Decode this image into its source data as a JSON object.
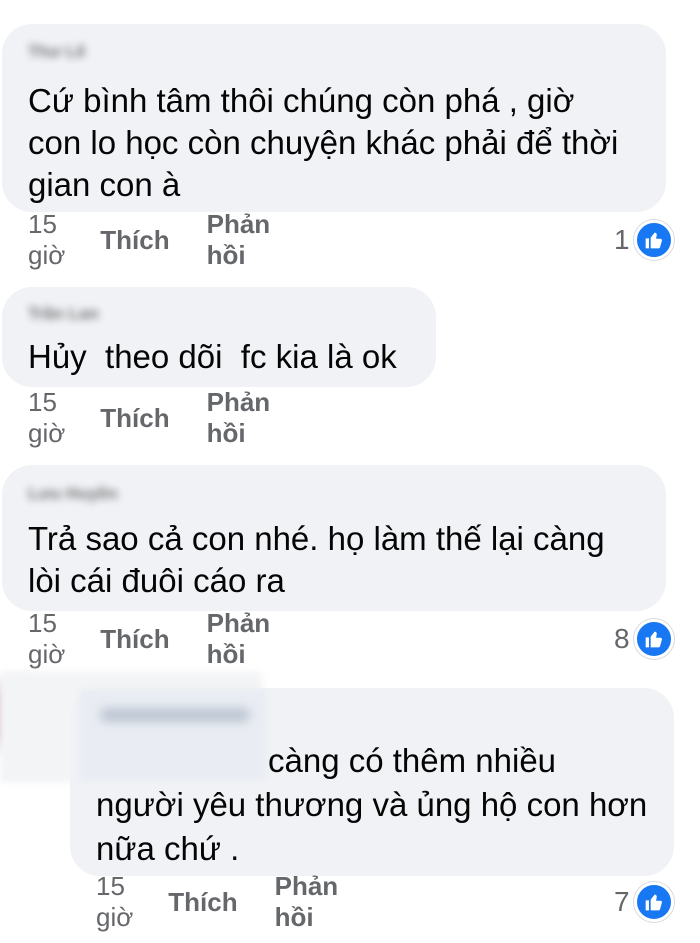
{
  "comments": [
    {
      "author": "Thư Lê",
      "line1": "Cứ bình tâm thôi chúng còn phá , giờ",
      "line2": "con lo học còn chuyện khác phải để thời",
      "line3": "gian con à",
      "time": "15 giờ",
      "like_label": "Thích",
      "reply_label": "Phản hồi",
      "reaction_count": "1"
    },
    {
      "author": "Trần Lan",
      "line1": "Hủy  theo dõi  fc kia là ok",
      "time": "15 giờ",
      "like_label": "Thích",
      "reply_label": "Phản hồi"
    },
    {
      "author": "Lưu Huyền",
      "line1": "Trả sao cả con nhé. họ làm thế lại càng",
      "line2": "lòi cái đuôi cáo ra",
      "time": "15 giờ",
      "like_label": "Thích",
      "reply_label": "Phản hồi",
      "reaction_count": "8"
    },
    {
      "line1": "càng có thêm nhiều",
      "line2": "người yêu thương và ủng hộ con hơn",
      "line3": "nữa chứ .",
      "time": "15 giờ",
      "like_label": "Thích",
      "reply_label": "Phản hồi",
      "reaction_count": "7"
    }
  ],
  "colors": {
    "bubble": "#f0f2f5",
    "text": "#050505",
    "meta": "#65676b",
    "like_blue": "#1877f2"
  },
  "icons": {
    "reaction": "thumbs-up-icon"
  }
}
